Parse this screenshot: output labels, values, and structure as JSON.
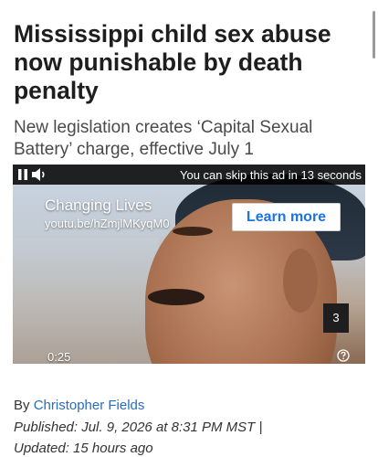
{
  "article": {
    "headline": "Mississippi child sex abuse now punishable by death penalty",
    "subhead": "New legislation creates ‘Capital Sexual Battery’ charge, effective July 1",
    "byline_prefix": "By",
    "author": "Christopher Fields",
    "published": "Published: Jul. 9, 2026 at 8:31 PM MST",
    "separator": "|",
    "updated": "Updated: 15 hours ago"
  },
  "video_ad": {
    "skip_text": "You can skip this ad in 13 seconds",
    "title": "Changing Lives",
    "url": "youtu.be/hZmjlMKyqM0",
    "cta_label": "Learn more",
    "slide_count": "3",
    "time": "0:25",
    "icons": [
      "pause-icon",
      "volume-icon",
      "help-icon"
    ]
  },
  "colors": {
    "link": "#2a6ebb",
    "cta": "#1a73e8"
  }
}
